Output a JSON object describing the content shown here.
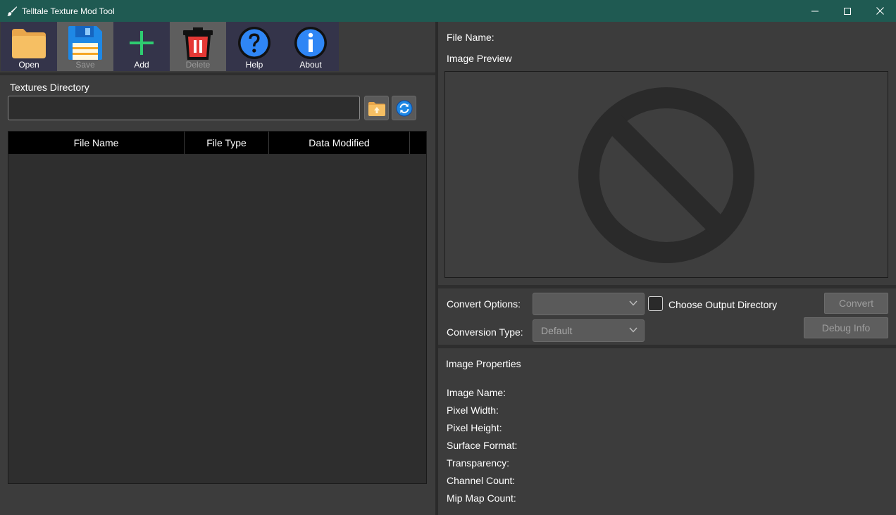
{
  "window": {
    "title": "Telltale Texture Mod Tool",
    "icon": "brush-icon"
  },
  "toolbar": {
    "items": [
      {
        "label": "Open",
        "icon": "folder-icon",
        "enabled": true
      },
      {
        "label": "Save",
        "icon": "floppy-disk-icon",
        "enabled": false
      },
      {
        "label": "Add",
        "icon": "plus-icon",
        "enabled": true
      },
      {
        "label": "Delete",
        "icon": "trash-icon",
        "enabled": false
      },
      {
        "label": "Help",
        "icon": "help-icon",
        "enabled": true
      },
      {
        "label": "About",
        "icon": "info-icon",
        "enabled": true
      }
    ]
  },
  "directory": {
    "label": "Textures Directory",
    "value": "",
    "placeholder": ""
  },
  "table": {
    "columns": [
      "File Name",
      "File Type",
      "Data Modified"
    ],
    "rows": []
  },
  "details": {
    "file_name_label": "File Name:",
    "image_preview_label": "Image Preview",
    "preview_icon": "no-image-icon"
  },
  "convert": {
    "options_label": "Convert Options:",
    "options_value": "",
    "output_dir_label": "Choose Output Directory",
    "output_dir_checked": false,
    "type_label": "Conversion Type:",
    "type_value": "Default",
    "convert_button": "Convert",
    "debug_button": "Debug Info"
  },
  "properties": {
    "title": "Image Properties",
    "fields": [
      "Image Name:",
      "Pixel Width:",
      "Pixel Height:",
      "Surface Format:",
      "Transparency:",
      "Channel Count:",
      "Mip Map Count:"
    ]
  },
  "colors": {
    "titlebar": "#1f5a52",
    "background": "#3c3c3c",
    "toolbar_button": "#34344a",
    "disabled_button": "#5e5e5e"
  }
}
